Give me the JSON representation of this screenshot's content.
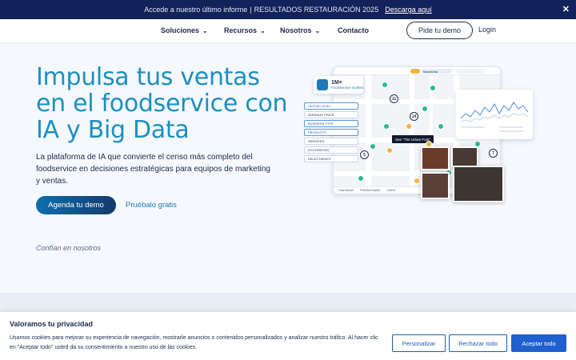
{
  "banner": {
    "text": "Accede a nuestro último informe",
    "separator": "|",
    "highlight": "RESULTADOS RESTAURACIÓN 2025",
    "link": "Descarga aquí",
    "close": "✕"
  },
  "nav": {
    "items": [
      {
        "label": "Soluciones",
        "dropdown": true
      },
      {
        "label": "Recursos",
        "dropdown": true
      },
      {
        "label": "Nosotros",
        "dropdown": true
      },
      {
        "label": "Contacto",
        "dropdown": false
      }
    ],
    "cta": "Pide tu demo",
    "login": "Login"
  },
  "hero": {
    "title": "Impulsa tus ventas en el foodservice con IA y Big Data",
    "subtitle": "La plataforma de IA que convierte el censo más completo del foodservice en decisiones estratégicas para equipos de marketing y ventas.",
    "primary_cta": "Agenda tu demo",
    "secondary_cta": "Pruébalo gratis",
    "trust": "Confían en nosotros"
  },
  "illustration": {
    "outlets_big": "1M+",
    "outlets_small": "Foodservice Outlets",
    "map_city": "Barcelona",
    "tooltip": "See \"The Urban Fork\"",
    "filters": [
      "DIGITAL LEVEL",
      "AVERAGE PRICE",
      "BUSINESS TYPE",
      "PRODUCTS",
      "SERVICES",
      "OCCUPATION",
      "DELECTARATE"
    ],
    "bottom_labels": [
      "Total Market",
      "Potential Market",
      "Clients"
    ],
    "cluster_numbers": [
      "11",
      "14",
      "5",
      "7"
    ]
  },
  "cookie": {
    "title": "Valoramos tu privacidad",
    "text": "Usamos cookies para mejorar su experiencia de navegación, mostrarle anuncios o contenidos personalizados y analizar nuestro tráfico. Al hacer clic en \"Aceptar todo\" usted da su consentimiento a nuestro uso de las cookies.",
    "customize": "Personalizar",
    "reject": "Rechazar todo",
    "accept": "Aceptar todo"
  },
  "colors": {
    "banner_bg": "#13225a",
    "title_blue": "#1d8fc2",
    "accept_blue": "#1f5fd0"
  }
}
